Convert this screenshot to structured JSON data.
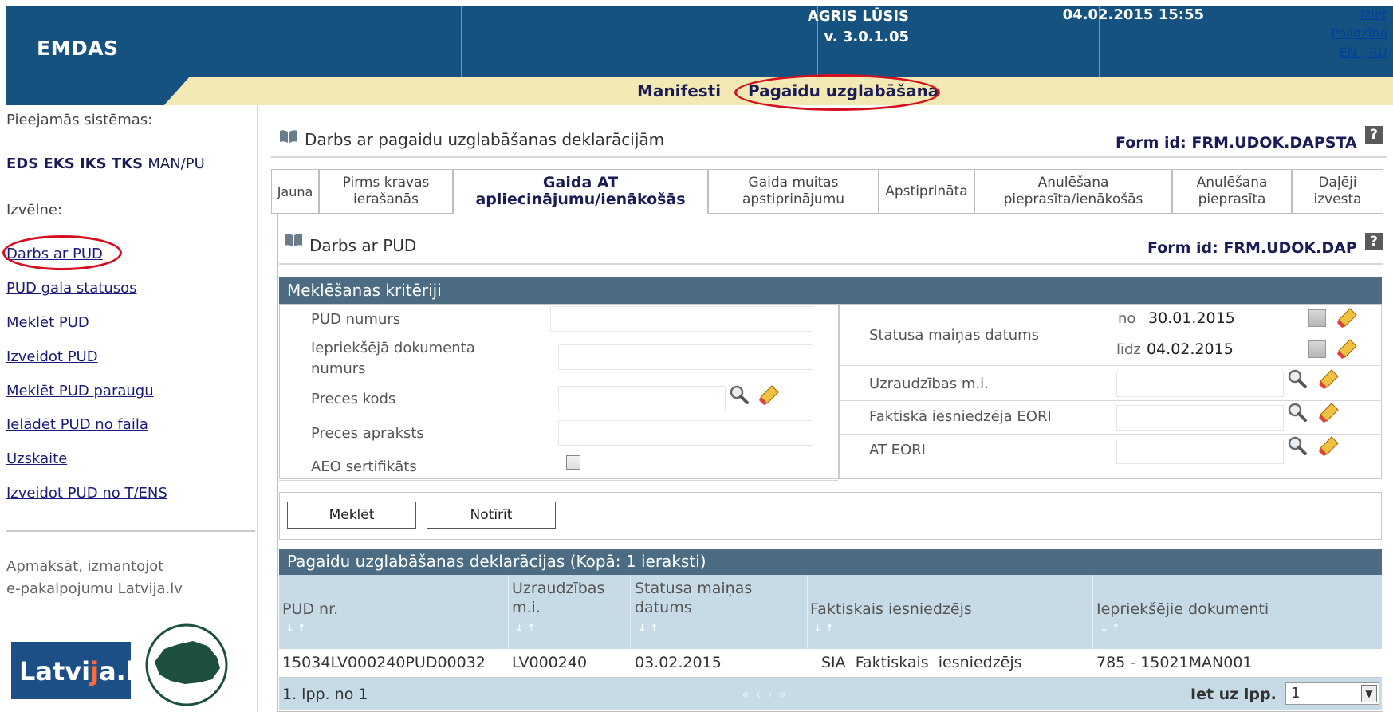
{
  "header": {
    "logo": "EMDAS",
    "user_name": "AGRIS LŪSIS",
    "version": "v. 3.0.1.05",
    "datetime": "04.02.2015 15:55",
    "links": [
      "Iziet",
      "Palīdzība",
      "EN | RU"
    ]
  },
  "topnav": {
    "items": [
      "Manifesti",
      "Pagaidu uzglabāšana"
    ],
    "active": "Pagaidu uzglabāšana"
  },
  "sidebar": {
    "available_label": "Pieejamās sistēmas:",
    "systems": [
      "EDS",
      "EKS",
      "IKS",
      "TKS",
      "MAN/PU"
    ],
    "menu_label": "Izvēlne:",
    "menu_items": [
      "Darbs ar PUD",
      "PUD gala statusos",
      "Meklēt PUD",
      "Izveidot PUD",
      "Meklēt PUD paraugu",
      "Ielādēt PUD no faila",
      "Uzskaite",
      "Izveidot PUD no T/ENS"
    ],
    "pay_text_1": "Apmaksāt, izmantojot",
    "pay_text_2": "e-pakalpojumu Latvija.lv",
    "logo_latvija_a": "Latvi",
    "logo_latvija_b": "j",
    "logo_latvija_c": "a.lv"
  },
  "page": {
    "title": "Darbs ar pagaidu uzglabāšanas deklarācijām",
    "form_id": "Form id: FRM.UDOK.DAPSTA",
    "help": "?"
  },
  "tabs": [
    {
      "line1": "Jauna",
      "line2": ""
    },
    {
      "line1": "Pirms kravas",
      "line2": "ierašanās"
    },
    {
      "line1": "Gaida AT",
      "line2": "apliecinājumu/ienākošās"
    },
    {
      "line1": "Gaida muitas",
      "line2": "apstiprinājumu"
    },
    {
      "line1": "Apstiprināta",
      "line2": ""
    },
    {
      "line1": "Anulēšana",
      "line2": "pieprasīta/ienākošās"
    },
    {
      "line1": "Anulēšana",
      "line2": "pieprasīta"
    },
    {
      "line1": "Daļēji",
      "line2": "izvesta"
    }
  ],
  "subform": {
    "title": "Darbs ar PUD",
    "form_id": "Form id: FRM.UDOK.DAP"
  },
  "criteria": {
    "header": "Meklēšanas kritēriji",
    "left": {
      "pud_number": "PUD numurs",
      "prev_doc_1": "Iepriekšējā dokumenta",
      "prev_doc_2": "numurs",
      "goods_code": "Preces kods",
      "goods_desc": "Preces apraksts",
      "aeo": "AEO sertifikāts"
    },
    "right": {
      "status_date": "Statusa maiņas datums",
      "from_label": "no",
      "from_value": "30.01.2015",
      "to_label": "līdz",
      "to_value": "04.02.2015",
      "supervision": "Uzraudzības m.i.",
      "eori_actual": "Faktiskā iesniedzēja EORI",
      "at_eori": "AT EORI"
    }
  },
  "buttons": {
    "search": "Meklēt",
    "clear": "Notīrīt"
  },
  "results": {
    "header": "Pagaidu uzglabāšanas deklarācijas (Kopā: 1 ieraksti)",
    "columns": [
      {
        "l1": "",
        "l2": "PUD nr."
      },
      {
        "l1": "Uzraudzības",
        "l2": "m.i."
      },
      {
        "l1": "Statusa maiņas",
        "l2": "datums"
      },
      {
        "l1": "",
        "l2": "Faktiskais iesniedzējs"
      },
      {
        "l1": "",
        "l2": "Iepriekšējie dokumenti"
      }
    ],
    "rows": [
      [
        "15034LV000240PUD00032",
        "LV000240",
        "03.02.2015",
        "SIA  Faktiskais  iesniedzējs",
        "785 - 15021MAN001"
      ]
    ],
    "pager": {
      "page_info": "1. lpp. no 1",
      "nav": "«‹›»",
      "goto_label": "Iet uz lpp.",
      "goto_value": "1"
    }
  }
}
